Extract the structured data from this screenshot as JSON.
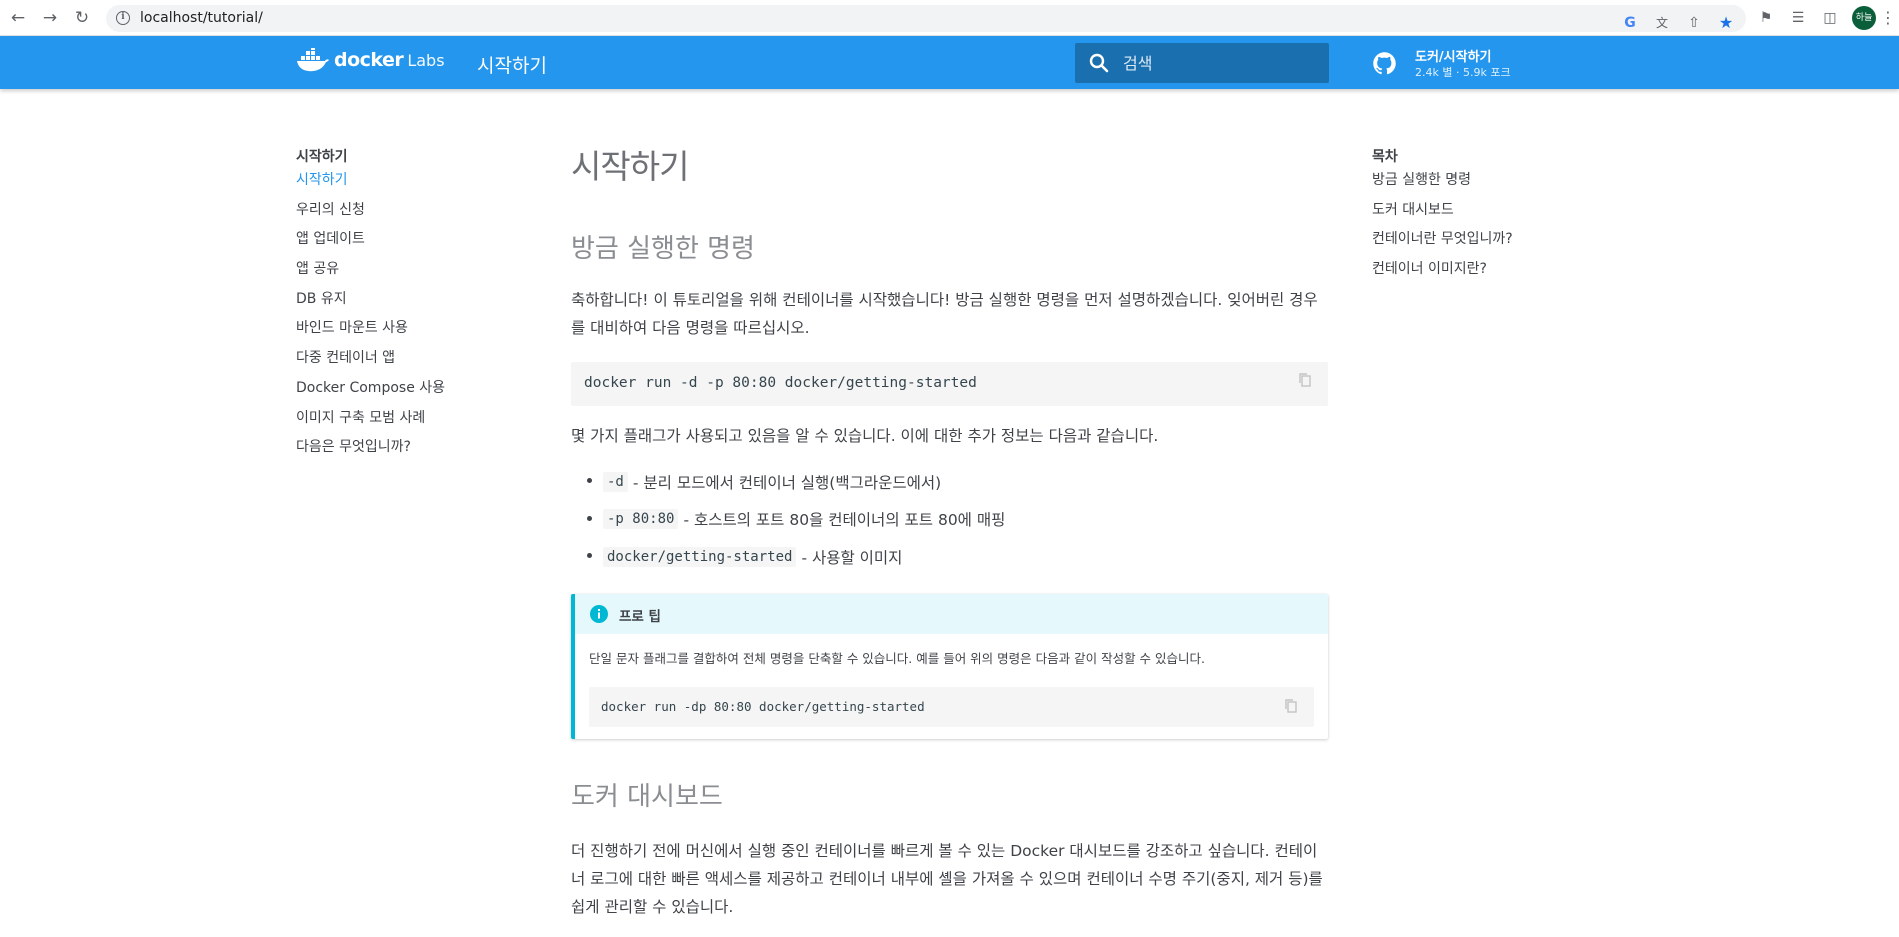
{
  "browser": {
    "url": "localhost/tutorial/",
    "profile_initials": "하늘"
  },
  "header": {
    "logo_text": "docker",
    "logo_sub": "Labs",
    "site_title": "시작하기",
    "search_placeholder": "검색",
    "repo_name": "도커/시작하기",
    "repo_facts": "2.4k 별 · 5.9k 포크"
  },
  "leftnav": {
    "heading": "시작하기",
    "items": [
      {
        "label": "시작하기",
        "active": true
      },
      {
        "label": "우리의 신청"
      },
      {
        "label": "앱 업데이트"
      },
      {
        "label": "앱 공유"
      },
      {
        "label": "DB 유지"
      },
      {
        "label": "바인드 마운트 사용"
      },
      {
        "label": "다중 컨테이너 앱"
      },
      {
        "label": "Docker Compose 사용"
      },
      {
        "label": "이미지 구축 모범 사례"
      },
      {
        "label": "다음은 무엇입니까?"
      }
    ]
  },
  "toc": {
    "heading": "목차",
    "items": [
      "방금 실행한 명령",
      "도커 대시보드",
      "컨테이너란 무엇입니까?",
      "컨테이너 이미지란?"
    ]
  },
  "main": {
    "title": "시작하기",
    "section1": {
      "heading": "방금 실행한 명령",
      "intro": "축하합니다! 이 튜토리얼을 위해 컨테이너를 시작했습니다! 방금 실행한 명령을 먼저 설명하겠습니다. 잊어버린 경우를 대비하여 다음 명령을 따르십시오.",
      "command": "docker run -d -p 80:80 docker/getting-started",
      "flags_intro": "몇 가지 플래그가 사용되고 있음을 알 수 있습니다. 이에 대한 추가 정보는 다음과 같습니다.",
      "flags": [
        {
          "code": "-d",
          "desc": "- 분리 모드에서 컨테이너 실행(백그라운드에서)"
        },
        {
          "code": "-p 80:80",
          "desc": "- 호스트의 포트 80을 컨테이너의 포트 80에 매핑"
        },
        {
          "code": "docker/getting-started",
          "desc": "- 사용할 이미지"
        }
      ]
    },
    "tip": {
      "title": "프로 팁",
      "text": "단일 문자 플래그를 결합하여 전체 명령을 단축할 수 있습니다. 예를 들어 위의 명령은 다음과 같이 작성할 수 있습니다.",
      "command": "docker run -dp 80:80 docker/getting-started"
    },
    "section2": {
      "heading": "도커 대시보드",
      "text": "더 진행하기 전에 머신에서 실행 중인 컨테이너를 빠르게 볼 수 있는 Docker 대시보드를 강조하고 싶습니다. 컨테이너 로그에 대한 빠른 액세스를 제공하고 컨테이너 내부에 셸을 가져올 수 있으며 컨테이너 수명 주기(중지, 제거 등)를 쉽게 관리할 수 있습니다."
    }
  }
}
